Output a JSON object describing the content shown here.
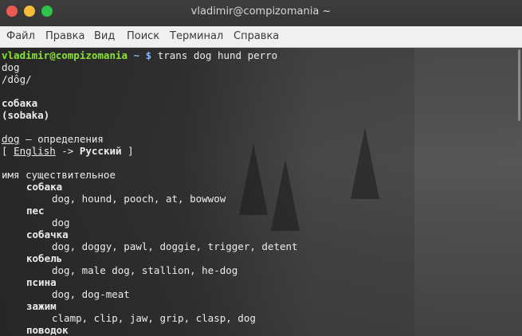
{
  "window": {
    "title": "vladimir@compizomania ~"
  },
  "menu": [
    "Файл",
    "Правка",
    "Вид",
    "Поиск",
    "Терминал",
    "Справка"
  ],
  "terminal": {
    "prompt_user": "vladimir@compizomania",
    "prompt_path": "~ $",
    "command": "trans dog hund perro",
    "word": "dog",
    "phonetic": "/dôg/",
    "translation": "собака",
    "translit": "(sobaka)",
    "def_word": "dog",
    "def_label": "— определения",
    "lang_open": "[",
    "lang_from": "English",
    "lang_arrow": "->",
    "lang_to": "Русский",
    "lang_close": "]",
    "pos": "имя существительное",
    "entries": [
      {
        "word": "собака",
        "synonyms": "dog, hound, pooch, at, bowwow"
      },
      {
        "word": "пес",
        "synonyms": "dog"
      },
      {
        "word": "собачка",
        "synonyms": "dog, doggy, pawl, doggie, trigger, detent"
      },
      {
        "word": "кобель",
        "synonyms": "dog, male dog, stallion, he-dog"
      },
      {
        "word": "псина",
        "synonyms": "dog, dog-meat"
      },
      {
        "word": "зажим",
        "synonyms": "clamp, clip, jaw, grip, clasp, dog"
      },
      {
        "word": "поводок",
        "synonyms": ""
      }
    ]
  }
}
